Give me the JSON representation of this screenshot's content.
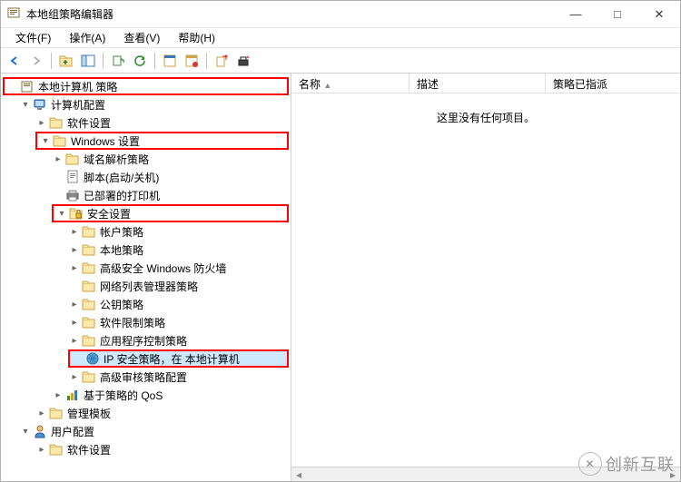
{
  "window": {
    "title": "本地组策略编辑器"
  },
  "menu": {
    "file": "文件(F)",
    "action": "操作(A)",
    "view": "查看(V)",
    "help": "帮助(H)"
  },
  "tree": {
    "root": "本地计算机 策略",
    "computer_config": "计算机配置",
    "software_settings": "软件设置",
    "windows_settings": "Windows 设置",
    "name_resolution": "域名解析策略",
    "scripts": "脚本(启动/关机)",
    "deployed_printers": "已部署的打印机",
    "security_settings": "安全设置",
    "account_policy": "帐户策略",
    "local_policy": "本地策略",
    "wfas": "高级安全 Windows 防火墙",
    "nlm": "网络列表管理器策略",
    "public_key": "公钥策略",
    "software_restriction": "软件限制策略",
    "app_control": "应用程序控制策略",
    "ipsec": "IP 安全策略，在 本地计算机",
    "audit": "高级审核策略配置",
    "qos": "基于策略的 QoS",
    "admin_templates": "管理模板",
    "user_config": "用户配置",
    "software_settings2": "软件设置"
  },
  "columns": {
    "name": "名称",
    "desc": "描述",
    "assigned": "策略已指派"
  },
  "content": {
    "empty": "这里没有任何项目。"
  },
  "watermark": "创新互联"
}
